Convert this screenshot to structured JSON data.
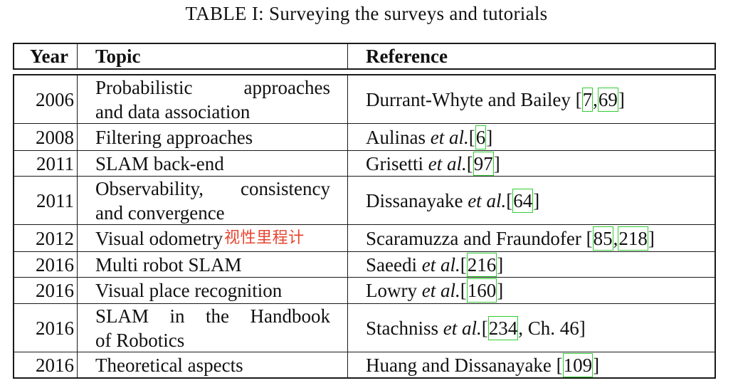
{
  "caption": "TABLE I: Surveying the surveys and tutorials",
  "headers": {
    "year": "Year",
    "topic": "Topic",
    "reference": "Reference"
  },
  "annotation": "视性里程计",
  "rows": [
    {
      "year": "2006",
      "topic_line1": "Probabilistic approaches",
      "topic_line2": "and data association",
      "ref_text": "Durrant-Whyte and Bailey [",
      "ref_cites": [
        "7",
        "69"
      ],
      "ref_sep": ", ",
      "ref_end": "]"
    },
    {
      "year": "2008",
      "topic": "Filtering approaches",
      "ref_author": "Aulinas ",
      "ref_etal": "et al.",
      "ref_open": " [",
      "ref_cite": "6",
      "ref_close": "]"
    },
    {
      "year": "2011",
      "topic": "SLAM back-end",
      "ref_author": "Grisetti ",
      "ref_etal": "et al.",
      "ref_open": " [",
      "ref_cite": "97",
      "ref_close": "]"
    },
    {
      "year": "2011",
      "topic_line1": "Observability, consistency",
      "topic_line2": "and convergence",
      "ref_author": "Dissanayake ",
      "ref_etal": "et al.",
      "ref_open": " [",
      "ref_cite": "64",
      "ref_close": "]"
    },
    {
      "year": "2012",
      "topic": "Visual odometry",
      "ref_text": "Scaramuzza and Fraundofer [",
      "ref_cites": [
        "85",
        "218"
      ],
      "ref_sep": ", ",
      "ref_end": "]"
    },
    {
      "year": "2016",
      "topic": "Multi robot SLAM",
      "ref_author": "Saeedi ",
      "ref_etal": "et al.",
      "ref_open": " [",
      "ref_cite": "216",
      "ref_close": "]"
    },
    {
      "year": "2016",
      "topic": "Visual place recognition",
      "ref_author": "Lowry ",
      "ref_etal": "et al.",
      "ref_open": " [",
      "ref_cite": "160",
      "ref_close": "]"
    },
    {
      "year": "2016",
      "topic_line1": "SLAM in the Handbook",
      "topic_line2": "of Robotics",
      "ref_author": "Stachniss ",
      "ref_etal": "et al.",
      "ref_open": " [",
      "ref_cite": "234",
      "ref_close": ", Ch. 46]"
    },
    {
      "year": "2016",
      "topic": "Theoretical aspects",
      "ref_text": "Huang and Dissanayake [",
      "ref_cite": "109",
      "ref_close": "]"
    }
  ]
}
